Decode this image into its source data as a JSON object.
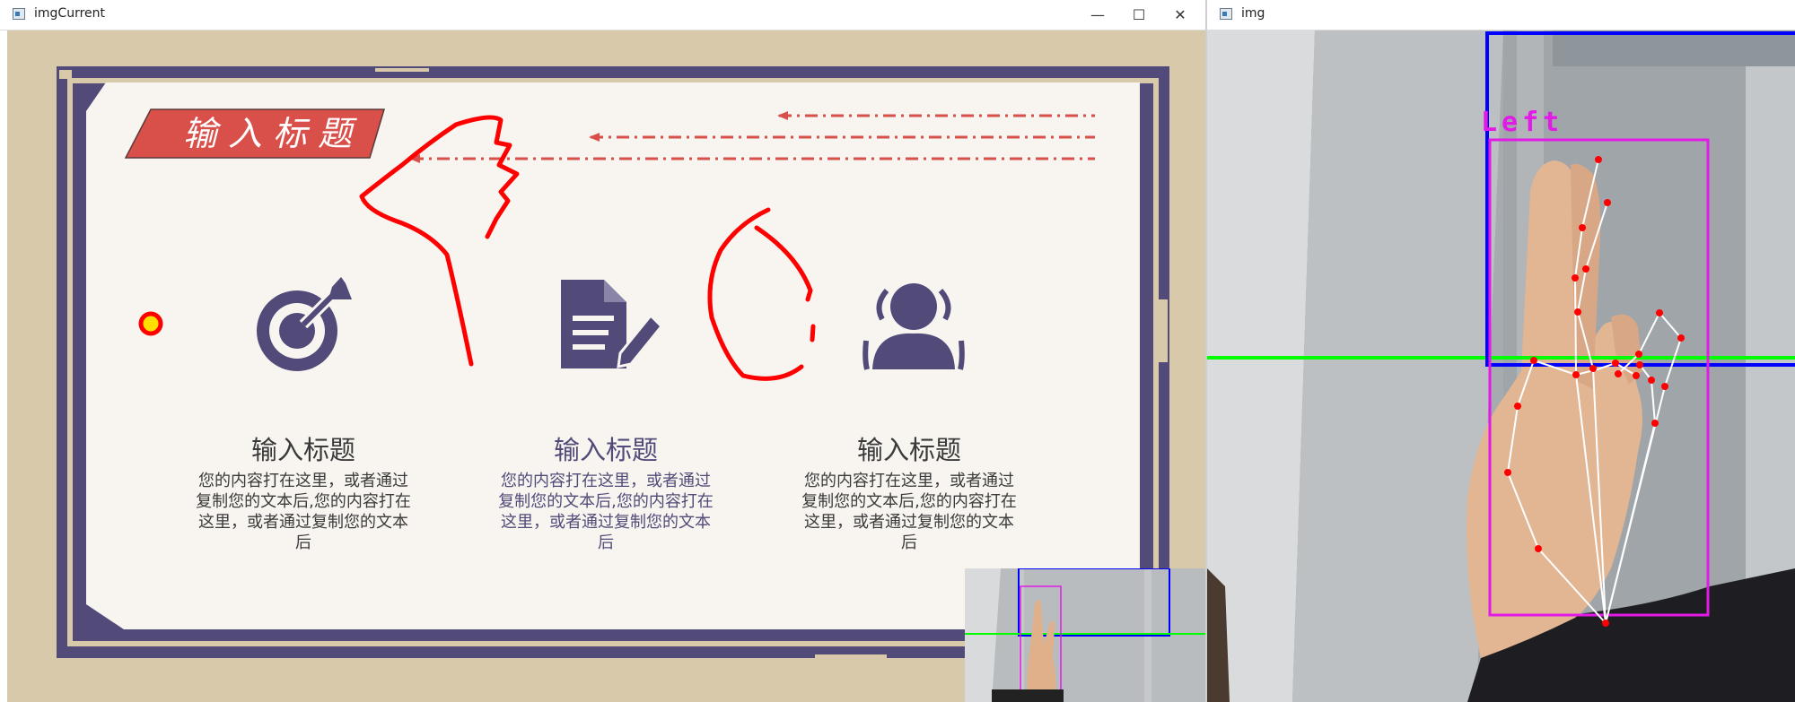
{
  "left_window": {
    "title": "imgCurrent",
    "controls": {
      "minimize": "—",
      "maximize": "☐",
      "close": "✕"
    },
    "slide": {
      "banner_title": "输 入 标 题",
      "cards": [
        {
          "icon": "target-icon",
          "title": "输入标题",
          "body": "您的内容打在这里，或者通过复制您的文本后,您的内容打在这里，或者通过复制您的文本后"
        },
        {
          "icon": "document-edit-icon",
          "title": "输入标题",
          "body": "您的内容打在这里，或者通过复制您的文本后,您的内容打在这里，或者通过复制您的文本后"
        },
        {
          "icon": "user-group-icon",
          "title": "输入标题",
          "body": "您的内容打在这里，或者通过复制您的文本后,您的内容打在这里，或者通过复制您的文本后"
        }
      ]
    }
  },
  "right_window": {
    "title": "img",
    "detection_label": "Left"
  },
  "colors": {
    "frame_purple": "#524a78",
    "banner_red": "#d9504a",
    "ink_red": "#ff0000",
    "hand_box": "#e21ae6",
    "region_box": "#0000ff",
    "guide_line": "#00ff00"
  }
}
